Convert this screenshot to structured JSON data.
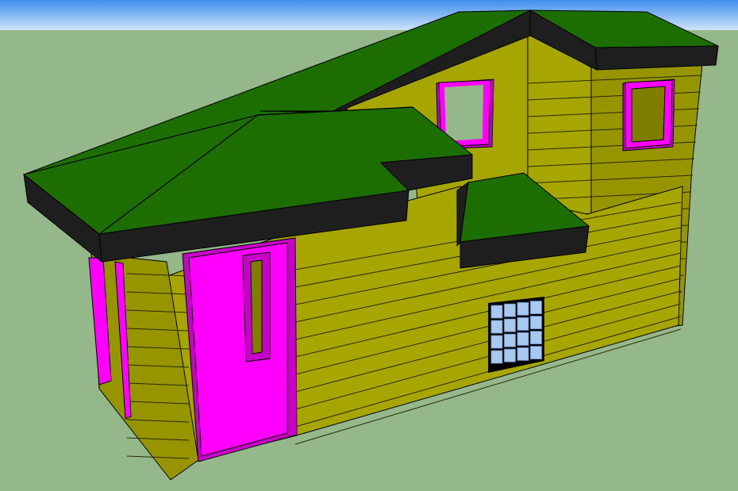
{
  "scene": {
    "subject": "tiny-house-3d-model",
    "colors": {
      "sky_top": "#3d8ef0",
      "sky_bottom": "#cfe4f8",
      "ground": "#94b88a",
      "siding_front": "#a7a600",
      "siding_side": "#969500",
      "siding_shade": "#7f7e00",
      "siding_line": "#2a2a00",
      "roof": "#1c6e00",
      "roof_fascia": "#1e1e1e",
      "trim": "#ff00ff",
      "trim_dark": "#c800c8",
      "window_glass": "#7f7e00",
      "glass_block": "#a8c8f0",
      "outline": "#000000"
    }
  }
}
